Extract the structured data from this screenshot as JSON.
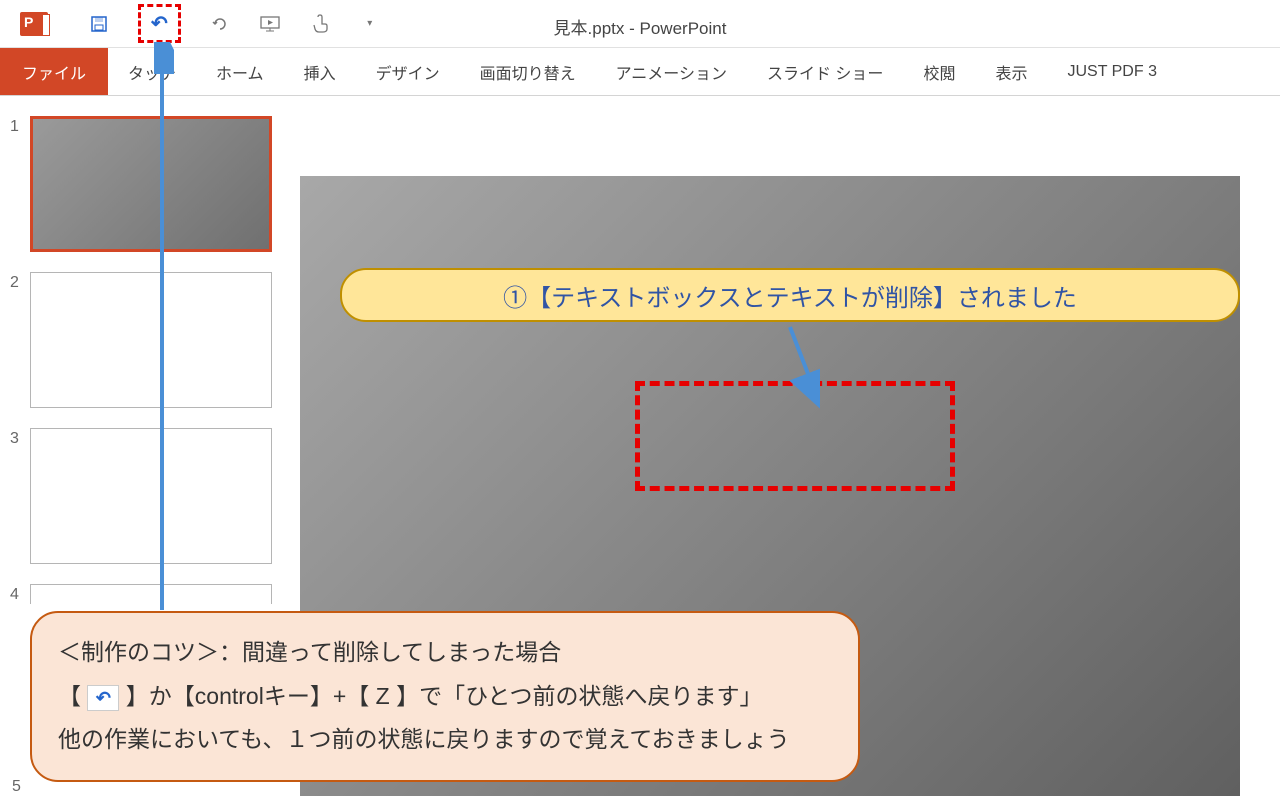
{
  "titlebar": {
    "title": "見本.pptx - PowerPoint"
  },
  "qat": {
    "save_name": "save-icon",
    "undo_name": "undo-icon",
    "redo_name": "redo-icon",
    "present_name": "present-from-start-icon",
    "touch_name": "touch-mode-icon",
    "customize_name": "customize-qat-icon"
  },
  "ribbon": {
    "tabs": [
      {
        "label": "ファイル",
        "id": "file"
      },
      {
        "label": "タッチ",
        "id": "touch"
      },
      {
        "label": "ホーム",
        "id": "home"
      },
      {
        "label": "挿入",
        "id": "insert"
      },
      {
        "label": "デザイン",
        "id": "design"
      },
      {
        "label": "画面切り替え",
        "id": "transitions"
      },
      {
        "label": "アニメーション",
        "id": "animations"
      },
      {
        "label": "スライド ショー",
        "id": "slideshow"
      },
      {
        "label": "校閲",
        "id": "review"
      },
      {
        "label": "表示",
        "id": "view"
      },
      {
        "label": "JUST PDF 3",
        "id": "justpdf"
      }
    ]
  },
  "thumbnails": {
    "items": [
      {
        "num": "1"
      },
      {
        "num": "2"
      },
      {
        "num": "3"
      },
      {
        "num": "4"
      },
      {
        "num": "5"
      }
    ]
  },
  "callout": {
    "text": "①【テキストボックスとテキストが削除】されました"
  },
  "tip": {
    "line1": "＜制作のコツ＞：間違って削除してしまった場合",
    "line2a": "【 ",
    "line2b": " 】か【controlキー】+【 Z 】で「ひとつ前の状態へ戻ります」",
    "line3": "他の作業においても、１つ前の状態に戻りますので覚えておきましょう",
    "undo_glyph": "↶"
  }
}
